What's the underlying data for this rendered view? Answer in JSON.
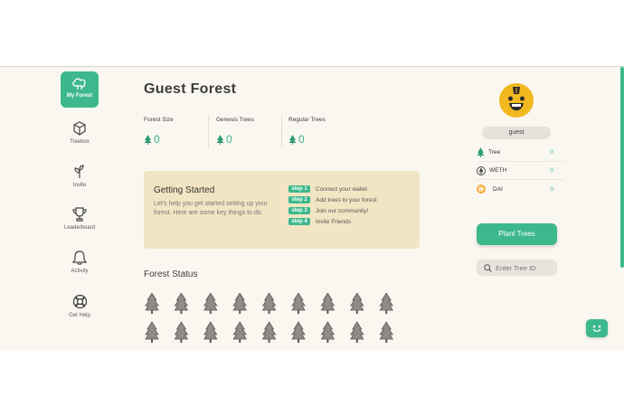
{
  "sidebar": {
    "items": [
      {
        "label": "My Forest",
        "icon": "forest-icon",
        "active": true
      },
      {
        "label": "Treebox",
        "icon": "box-icon"
      },
      {
        "label": "Invite",
        "icon": "sprout-icon"
      },
      {
        "label": "Leaderboard",
        "icon": "trophy-icon"
      },
      {
        "label": "Activity",
        "icon": "bell-icon"
      },
      {
        "label": "Get Help",
        "icon": "lifebuoy-icon"
      }
    ]
  },
  "main": {
    "title": "Guest Forest",
    "stats": [
      {
        "label": "Forest Size",
        "value": "0"
      },
      {
        "label": "Genesis Trees",
        "value": "0"
      },
      {
        "label": "Regular Trees",
        "value": "0"
      }
    ],
    "getting_started": {
      "title": "Getting Started",
      "description": "Let's help you get started setting up your forest. Here are some key things to do.",
      "steps": [
        {
          "badge": "step 1",
          "text": "Connect your wallet"
        },
        {
          "badge": "step 2",
          "text": "Add trees to your forest"
        },
        {
          "badge": "step 3",
          "text": "Join our community!"
        },
        {
          "badge": "step 4",
          "text": "Invite Friends"
        }
      ]
    },
    "forest_status_title": "Forest Status",
    "tree_count": 18
  },
  "right_panel": {
    "username": "guest",
    "tokens": [
      {
        "name": "Tree",
        "value": "0",
        "icon": "tree-icon"
      },
      {
        "name": "WETH",
        "value": "0",
        "icon": "ethereum-icon"
      },
      {
        "name": "DAI",
        "value": "0",
        "icon": "dai-icon"
      }
    ],
    "plant_button": "Plant Trees",
    "search_placeholder": "Enter Tree ID"
  },
  "colors": {
    "accent": "#3cb88c",
    "background": "#faf7f1",
    "card": "#f2e5c3",
    "avatar": "#f2b81f"
  }
}
